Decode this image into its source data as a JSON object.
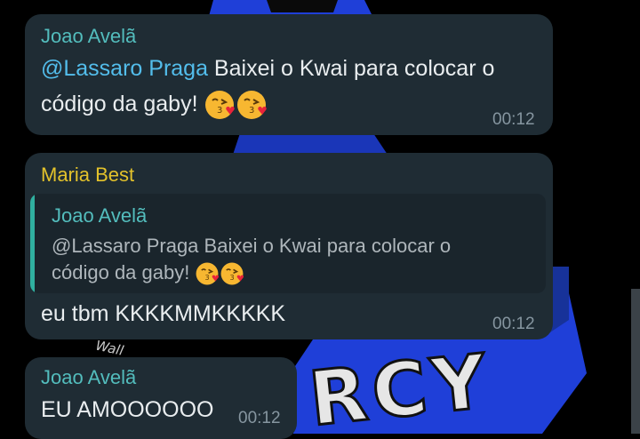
{
  "colors": {
    "sender_joao": "#53bdbd",
    "sender_maria": "#e3c22b",
    "mention": "#53bdeb",
    "bubble_bg": "#1f2c34",
    "quote_bar": "#30b0a0",
    "wallpaper_accent": "#1f3fd8"
  },
  "wallpaper": {
    "graffiti_text": "RCY",
    "tag_text": "Wall"
  },
  "messages": [
    {
      "sender": "Joao Avelã",
      "mention": "@Lassaro Praga",
      "line1_rest": " Baixei o Kwai para colocar o",
      "line2": "código da gaby! ",
      "emojis": [
        "kissing-heart-emoji",
        "kissing-heart-emoji"
      ],
      "time": "00:12"
    },
    {
      "sender": "Maria Best",
      "quote": {
        "sender": "Joao Avelã",
        "line1": "@Lassaro Praga Baixei o Kwai para colocar o",
        "line2": "código da gaby! ",
        "emojis": [
          "kissing-heart-emoji",
          "kissing-heart-emoji"
        ]
      },
      "text": "eu tbm KKKKMMKKKKK",
      "time": "00:12"
    },
    {
      "sender": "Joao Avelã",
      "text": "EU AMOOOOOO",
      "time": "00:12"
    }
  ]
}
